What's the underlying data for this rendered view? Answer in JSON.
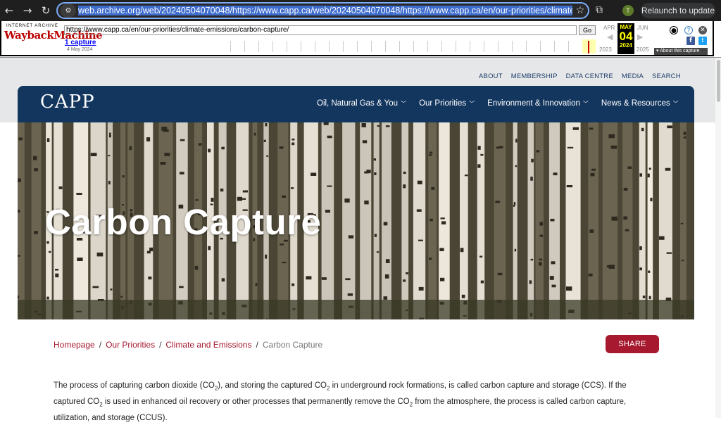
{
  "browser": {
    "url_highlight": "web.archive.org/web/20240504070048/https://www.capp.ca/web/20240504070048/https://www.capp.ca/en/our-priorities/climate-emissions/carbo",
    "relaunch_label": "Relaunch to update",
    "profile_initial": "T"
  },
  "wayback": {
    "logo_top": "INTERNET ARCHIVE",
    "logo_main": "WaybackMachine",
    "url": "https://www.capp.ca/en/our-priorities/climate-emissions/carbon-capture/",
    "go_label": "Go",
    "captures": "1 capture",
    "capture_date": "4 May 2024",
    "prev_month": "APR",
    "cur_month": "MAY",
    "next_month": "JUN",
    "cur_day": "04",
    "prev_year": "2023",
    "cur_year": "2024",
    "next_year": "2025",
    "about": "About this capture"
  },
  "util_nav": [
    "ABOUT",
    "MEMBERSHIP",
    "DATA CENTRE",
    "MEDIA",
    "SEARCH"
  ],
  "logo": "CAPP",
  "main_nav": [
    "Oil, Natural Gas & You",
    "Our Priorities",
    "Environment & Innovation",
    "News & Resources"
  ],
  "hero_title": "Carbon Capture",
  "breadcrumb": [
    "Homepage",
    "Our Priorities",
    "Climate and Emissions",
    "Carbon Capture"
  ],
  "share_label": "SHARE",
  "body": {
    "p1_a": "The process of capturing carbon dioxide (CO",
    "p1_b": "), and storing the captured CO",
    "p1_c": " in underground rock formations, is called carbon capture and storage (CCS). If the captured CO",
    "p1_d": " is used in enhanced oil recovery or other processes that permanently remove the CO",
    "p1_e": " from the atmosphere, the process is called carbon capture, utilization, and storage (CCUS).",
    "sub": "2"
  },
  "colors": {
    "navy": "#13365f",
    "crimson": "#a6192e"
  }
}
